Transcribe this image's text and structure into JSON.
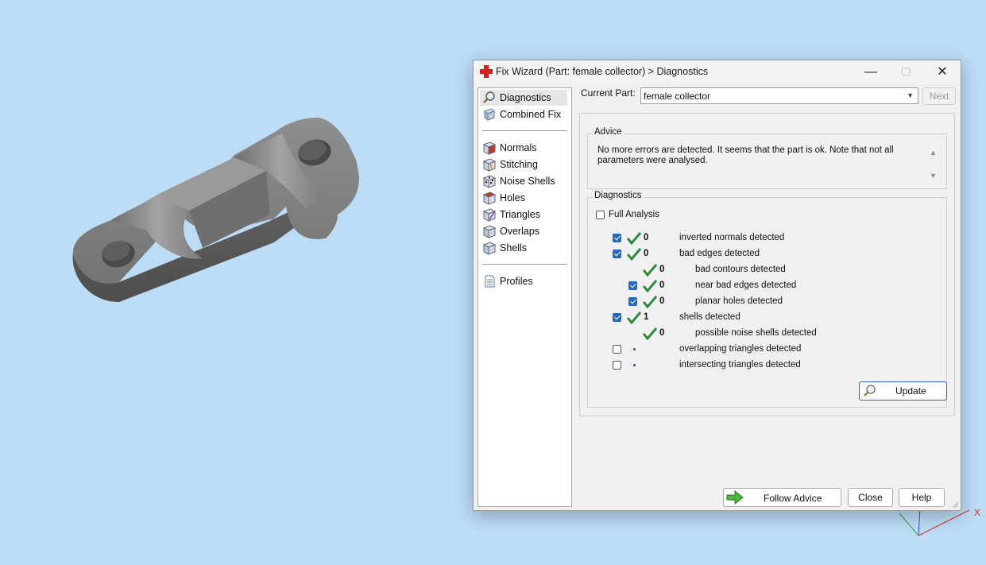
{
  "window": {
    "title": "Fix Wizard (Part: female collector) > Diagnostics",
    "minimize_glyph": "—",
    "maximize_glyph": "□",
    "close_glyph": "✕"
  },
  "nav": {
    "items": [
      {
        "label": "Diagnostics",
        "icon": "magnifier-icon",
        "selected": true
      },
      {
        "label": "Combined Fix",
        "icon": "combined-fix-icon"
      },
      {
        "label": "Normals",
        "icon": "normals-cube-icon"
      },
      {
        "label": "Stitching",
        "icon": "stitching-cube-icon"
      },
      {
        "label": "Noise Shells",
        "icon": "noise-shells-icon"
      },
      {
        "label": "Holes",
        "icon": "holes-cube-icon"
      },
      {
        "label": "Triangles",
        "icon": "triangles-cube-icon"
      },
      {
        "label": "Overlaps",
        "icon": "overlaps-cube-icon"
      },
      {
        "label": "Shells",
        "icon": "shells-cube-icon"
      },
      {
        "label": "Profiles",
        "icon": "profiles-document-icon"
      }
    ]
  },
  "current_part": {
    "label": "Current Part:",
    "value": "female collector"
  },
  "next_button": "Next",
  "advice": {
    "title": "Advice",
    "text": "No more errors are detected. It seems that the part is ok. Note that not all parameters were analysed."
  },
  "diagnostics": {
    "title": "Diagnostics",
    "full_analysis_label": "Full Analysis",
    "full_analysis_checked": false,
    "rows": [
      {
        "checked": true,
        "status": "ok",
        "count": "0",
        "label": "inverted normals detected"
      },
      {
        "checked": true,
        "status": "ok",
        "count": "0",
        "label": "bad edges detected"
      },
      {
        "checked": null,
        "status": "ok",
        "count": "0",
        "label": "bad contours detected"
      },
      {
        "checked": true,
        "status": "ok",
        "count": "0",
        "label": "near bad edges detected"
      },
      {
        "checked": true,
        "status": "ok",
        "count": "0",
        "label": "planar holes detected"
      },
      {
        "checked": true,
        "status": "ok",
        "count": "1",
        "label": "shells detected"
      },
      {
        "checked": null,
        "status": "ok",
        "count": "0",
        "label": "possible noise shells detected"
      },
      {
        "checked": false,
        "status": "pending",
        "count": "",
        "label": "overlapping triangles detected"
      },
      {
        "checked": false,
        "status": "pending",
        "count": "",
        "label": "intersecting triangles detected"
      }
    ],
    "update_button": "Update"
  },
  "footer": {
    "follow_advice": "Follow Advice",
    "close": "Close",
    "help": "Help"
  },
  "axes": {
    "x_label": "X"
  },
  "colors": {
    "background": "#bddcf6",
    "check_green": "#2e8b3e",
    "checkbox_blue": "#2768b8",
    "accent_border": "#2b63b7",
    "model_gray": "#7a7a7a"
  }
}
